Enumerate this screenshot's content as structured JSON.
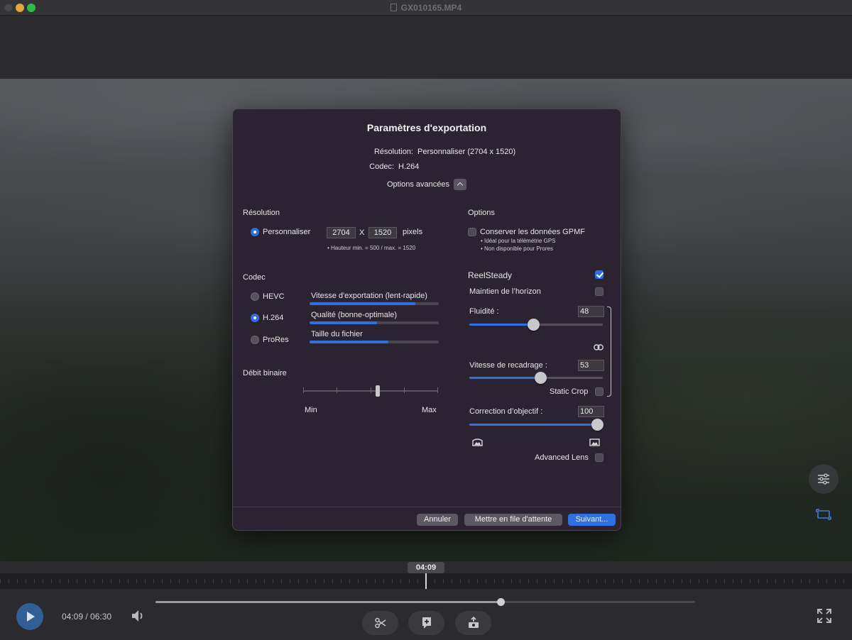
{
  "window": {
    "title": "GX010165.MP4"
  },
  "dialog": {
    "title": "Paramètres d'exportation",
    "summary": {
      "resolution_label": "Résolution:",
      "resolution_value": "Personnaliser (2704 x 1520)",
      "codec_label": "Codec:",
      "codec_value": "H.264"
    },
    "advanced_label": "Options avancées",
    "resolution_section": {
      "title": "Résolution",
      "option_label": "Personnaliser",
      "width": "2704",
      "x_label": "X",
      "height": "1520",
      "unit": "pixels",
      "note": "• Hauteur min. = 500 / max. = 1520"
    },
    "options_section": {
      "title": "Options",
      "gpmf_label": "Conserver les données GPMF",
      "gpmf_checked": false,
      "notes": [
        "• Idéal pour la télémétrie GPS",
        "• Non disponible pour Prores"
      ]
    },
    "codec_section": {
      "title": "Codec",
      "options": [
        {
          "label": "HEVC",
          "selected": false
        },
        {
          "label": "H.264",
          "selected": true
        },
        {
          "label": "ProRes",
          "selected": false
        }
      ],
      "metrics": [
        {
          "label": "Vitesse d'exportation (lent-rapide)",
          "value": 0.82
        },
        {
          "label": "Qualité (bonne-optimale)",
          "value": 0.52
        },
        {
          "label": "Taille du fichier",
          "value": 0.61
        }
      ]
    },
    "bitrate_section": {
      "title": "Débit binaire",
      "min_label": "Min",
      "max_label": "Max",
      "value": 0.55
    },
    "reelsteady": {
      "label": "ReelSteady",
      "checked": true,
      "horizon_label": "Maintien de l’horizon",
      "horizon_checked": false,
      "smoothness_label": "Fluidité :",
      "smoothness_value": "48",
      "smoothness_level": 0.48,
      "crop_speed_label": "Vitesse de recadrage :",
      "crop_speed_value": "53",
      "crop_speed_level": 0.53,
      "static_crop_label": "Static Crop",
      "static_crop_checked": false,
      "lens_label": "Correction d’objectif :",
      "lens_value": "100",
      "lens_level": 1.0,
      "advanced_lens_label": "Advanced Lens",
      "advanced_lens_checked": false
    },
    "buttons": {
      "cancel": "Annuler",
      "queue": "Mettre en file d'attente",
      "next": "Suivant..."
    }
  },
  "player": {
    "playhead_time": "04:09",
    "time_display": "04:09 / 06:30",
    "progress": 0.64,
    "accent": "#2f6fe0"
  }
}
